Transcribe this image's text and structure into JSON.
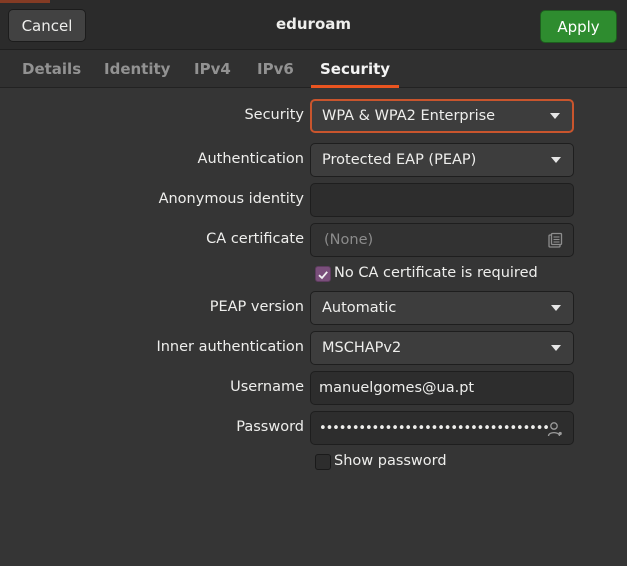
{
  "header": {
    "cancel_label": "Cancel",
    "title": "eduroam",
    "apply_label": "Apply"
  },
  "tabs": [
    {
      "label": "Details",
      "active": false
    },
    {
      "label": "Identity",
      "active": false
    },
    {
      "label": "IPv4",
      "active": false
    },
    {
      "label": "IPv6",
      "active": false
    },
    {
      "label": "Security",
      "active": true
    }
  ],
  "form": {
    "security": {
      "label": "Security",
      "value": "WPA & WPA2 Enterprise"
    },
    "authentication": {
      "label": "Authentication",
      "value": "Protected EAP (PEAP)"
    },
    "anonymous_identity": {
      "label": "Anonymous identity",
      "value": ""
    },
    "ca_certificate": {
      "label": "CA certificate",
      "value": "(None)",
      "icon": "file-chooser-icon"
    },
    "no_ca_required": {
      "label": "No CA certificate is required",
      "checked": true
    },
    "peap_version": {
      "label": "PEAP version",
      "value": "Automatic"
    },
    "inner_auth": {
      "label": "Inner authentication",
      "value": "MSCHAPv2"
    },
    "username": {
      "label": "Username",
      "value": "manuelgomes@ua.pt"
    },
    "password": {
      "label": "Password",
      "value": "•••••••••••••••••••••••••••••••••••",
      "icon": "user-password-icon"
    },
    "show_password": {
      "label": "Show password",
      "checked": false
    }
  },
  "colors": {
    "accent": "#e95420",
    "apply": "#2e8c2f",
    "checkbox_on": "#7a4f7b"
  }
}
